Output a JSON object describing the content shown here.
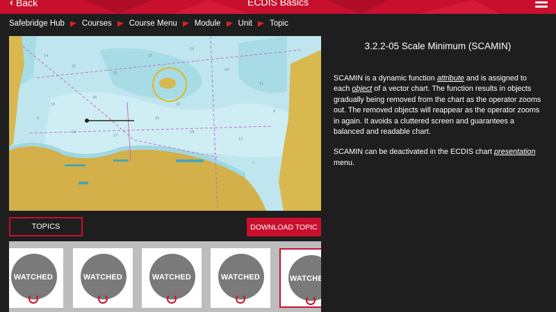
{
  "header": {
    "back_label": "Back",
    "title": "ECDIS Basics",
    "color": "#c8102e"
  },
  "breadcrumb": [
    "Safebridge Hub",
    "Courses",
    "Course Menu",
    "Module",
    "Unit",
    "Topic"
  ],
  "lesson": {
    "title": "3.2.2-05 Scale Minimum (SCAMIN)",
    "p1_a": "SCAMIN is a dynamic function ",
    "p1_link1": "attribute",
    "p1_b": " and is assigned to each ",
    "p1_link2": "object",
    "p1_c": " of a vector chart. The function results in objects gradually being removed from the chart as the operator zooms out. The removed objects will reappear as the operator zooms in again. It avoids a cluttered screen and guarantees a balanced and readable chart.",
    "p2_a": "SCAMIN can be deactivated in the ECDIS chart ",
    "p2_link": "presentation",
    "p2_b": " menu."
  },
  "buttons": {
    "topics": "TOPICS",
    "download": "DOWNLOAD TOPIC"
  },
  "topic_cards": [
    {
      "status": "WATCHED",
      "active": false
    },
    {
      "status": "WATCHED",
      "active": false
    },
    {
      "status": "WATCHED",
      "active": false
    },
    {
      "status": "WATCHED",
      "active": false
    },
    {
      "status": "WATCHED",
      "active": true
    }
  ],
  "icons": {
    "back": "chevron-left-icon",
    "menu": "hamburger-menu-icon",
    "breadcrumb_separator": "red-arrow-icon"
  }
}
